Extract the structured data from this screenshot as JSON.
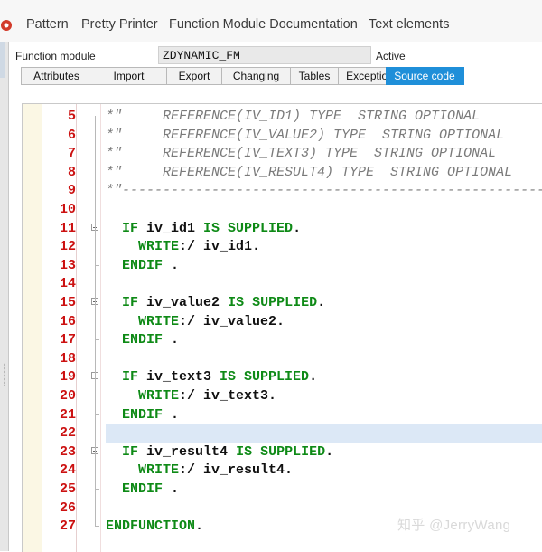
{
  "toolbar": {
    "items": [
      "Pattern",
      "Pretty Printer",
      "Function Module Documentation",
      "Text elements"
    ]
  },
  "header": {
    "label": "Function module",
    "name": "ZDYNAMIC_FM",
    "status": "Active"
  },
  "tabs": [
    {
      "label": "Attributes",
      "active": false
    },
    {
      "label": "Import",
      "active": false
    },
    {
      "label": "Export",
      "active": false
    },
    {
      "label": "Changing",
      "active": false
    },
    {
      "label": "Tables",
      "active": false
    },
    {
      "label": "Exceptions",
      "active": false
    },
    {
      "label": "Source code",
      "active": true
    }
  ],
  "code_lines": [
    {
      "num": "5",
      "parts": [
        {
          "t": "*\"     REFERENCE(IV_ID1) TYPE  STRING OPTIONAL",
          "c": "cm"
        }
      ]
    },
    {
      "num": "6",
      "parts": [
        {
          "t": "*\"     REFERENCE(IV_VALUE2) TYPE  STRING OPTIONAL",
          "c": "cm"
        }
      ]
    },
    {
      "num": "7",
      "parts": [
        {
          "t": "*\"     REFERENCE(IV_TEXT3) TYPE  STRING OPTIONAL",
          "c": "cm"
        }
      ]
    },
    {
      "num": "8",
      "parts": [
        {
          "t": "*\"     REFERENCE(IV_RESULT4) TYPE  STRING OPTIONAL",
          "c": "cm"
        }
      ]
    },
    {
      "num": "9",
      "parts": [
        {
          "t": "*\"---------------------------------------------------------------",
          "c": "cm"
        }
      ]
    },
    {
      "num": "10",
      "parts": []
    },
    {
      "num": "11",
      "fold": true,
      "parts": [
        {
          "t": "  "
        },
        {
          "t": "IF",
          "c": "kw"
        },
        {
          "t": " iv_id1 ",
          "c": "tx"
        },
        {
          "t": "IS SUPPLIED",
          "c": "kw"
        },
        {
          "t": ".",
          "c": "tx"
        }
      ]
    },
    {
      "num": "12",
      "parts": [
        {
          "t": "    "
        },
        {
          "t": "WRITE",
          "c": "kw"
        },
        {
          "t": ":/ iv_id1.",
          "c": "tx"
        }
      ]
    },
    {
      "num": "13",
      "parts": [
        {
          "t": "  "
        },
        {
          "t": "ENDIF",
          "c": "kw"
        },
        {
          "t": " .",
          "c": "tx"
        }
      ]
    },
    {
      "num": "14",
      "parts": []
    },
    {
      "num": "15",
      "fold": true,
      "parts": [
        {
          "t": "  "
        },
        {
          "t": "IF",
          "c": "kw"
        },
        {
          "t": " iv_value2 ",
          "c": "tx"
        },
        {
          "t": "IS SUPPLIED",
          "c": "kw"
        },
        {
          "t": ".",
          "c": "tx"
        }
      ]
    },
    {
      "num": "16",
      "parts": [
        {
          "t": "    "
        },
        {
          "t": "WRITE",
          "c": "kw"
        },
        {
          "t": ":/ iv_value2.",
          "c": "tx"
        }
      ]
    },
    {
      "num": "17",
      "parts": [
        {
          "t": "  "
        },
        {
          "t": "ENDIF",
          "c": "kw"
        },
        {
          "t": " .",
          "c": "tx"
        }
      ]
    },
    {
      "num": "18",
      "parts": []
    },
    {
      "num": "19",
      "fold": true,
      "parts": [
        {
          "t": "  "
        },
        {
          "t": "IF",
          "c": "kw"
        },
        {
          "t": " iv_text3 ",
          "c": "tx"
        },
        {
          "t": "IS SUPPLIED",
          "c": "kw"
        },
        {
          "t": ".",
          "c": "tx"
        }
      ]
    },
    {
      "num": "20",
      "parts": [
        {
          "t": "    "
        },
        {
          "t": "WRITE",
          "c": "kw"
        },
        {
          "t": ":/ iv_text3.",
          "c": "tx"
        }
      ]
    },
    {
      "num": "21",
      "parts": [
        {
          "t": "  "
        },
        {
          "t": "ENDIF",
          "c": "kw"
        },
        {
          "t": " .",
          "c": "tx"
        }
      ]
    },
    {
      "num": "22",
      "current": true,
      "parts": []
    },
    {
      "num": "23",
      "fold": true,
      "parts": [
        {
          "t": "  "
        },
        {
          "t": "IF",
          "c": "kw"
        },
        {
          "t": " iv_result4 ",
          "c": "tx"
        },
        {
          "t": "IS SUPPLIED",
          "c": "kw"
        },
        {
          "t": ".",
          "c": "tx"
        }
      ]
    },
    {
      "num": "24",
      "parts": [
        {
          "t": "    "
        },
        {
          "t": "WRITE",
          "c": "kw"
        },
        {
          "t": ":/ iv_result4.",
          "c": "tx"
        }
      ]
    },
    {
      "num": "25",
      "parts": [
        {
          "t": "  "
        },
        {
          "t": "ENDIF",
          "c": "kw"
        },
        {
          "t": " .",
          "c": "tx"
        }
      ]
    },
    {
      "num": "26",
      "parts": []
    },
    {
      "num": "27",
      "parts": [
        {
          "t": "ENDFUNCTION",
          "c": "kw"
        },
        {
          "t": ".",
          "c": "tx"
        }
      ]
    }
  ],
  "watermark": "知乎 @JerryWang"
}
